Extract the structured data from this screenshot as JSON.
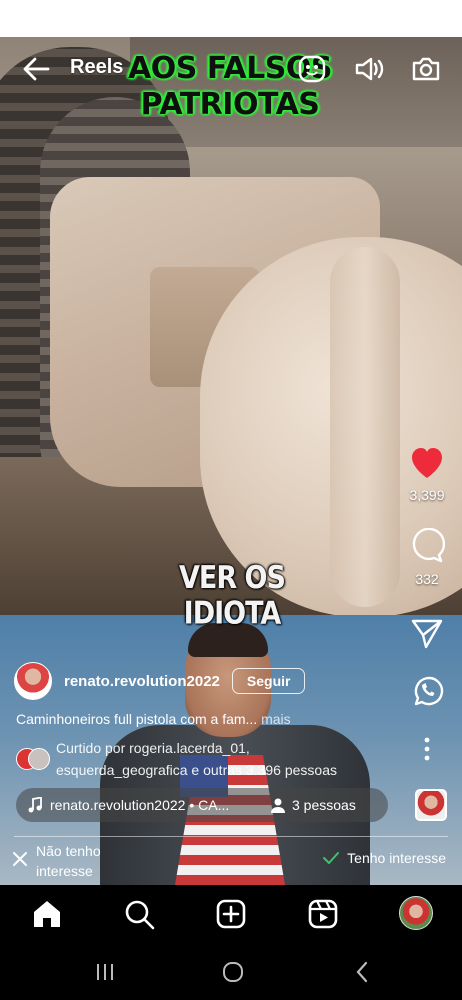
{
  "header": {
    "title": "Reels",
    "icons": [
      "back-arrow-icon",
      "effects-icon",
      "volume-icon",
      "camera-icon"
    ]
  },
  "video": {
    "caption_top": "AOS FALSOS PATRIOTAS",
    "caption_mid": "VER OS IDIOTA",
    "caption_color": "#2ff23a"
  },
  "actions": {
    "like_count": "3,399",
    "comment_count": "332",
    "like_color": "#ed2b3a"
  },
  "author": {
    "username": "renato.revolution2022",
    "follow_label": "Seguir"
  },
  "description": {
    "text": "Caminhoneiros full pistola com a fam...",
    "more_label": "mais"
  },
  "liked_by": {
    "line1": "Curtido por rogeria.lacerda_01,",
    "line2": "esquerda_geografica e outras 3.396 pessoas"
  },
  "audio": {
    "text": "renato.revolution2022 • CA...",
    "people": "3 pessoas"
  },
  "feedback": {
    "not_interested": "Não tenho interesse",
    "interested": "Tenho interesse"
  },
  "bottom_nav": {
    "items": [
      "home-icon",
      "search-icon",
      "create-icon",
      "reels-icon",
      "profile-avatar"
    ]
  },
  "system_nav": [
    "recent-apps-icon",
    "home-circle-icon",
    "back-chevron-icon"
  ]
}
